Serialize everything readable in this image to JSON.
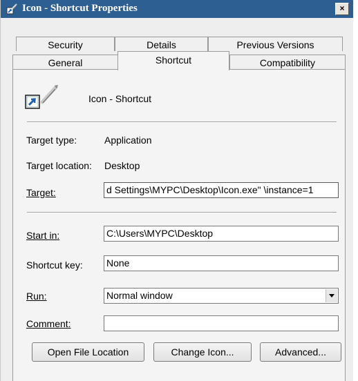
{
  "window": {
    "title": "Icon - Shortcut Properties",
    "close_glyph": "×"
  },
  "tabs": {
    "row1": [
      {
        "label": "Security"
      },
      {
        "label": "Details"
      },
      {
        "label": "Previous Versions"
      }
    ],
    "row2": [
      {
        "label": "General"
      },
      {
        "label": "Shortcut",
        "active": true
      },
      {
        "label": "Compatibility"
      }
    ]
  },
  "header": {
    "name": "Icon - Shortcut"
  },
  "info": {
    "target_type_label": "Target type:",
    "target_type_value": "Application",
    "target_location_label": "Target location:",
    "target_location_value": "Desktop"
  },
  "target": {
    "label": "Target:",
    "value": "d Settings\\MYPC\\Desktop\\Icon.exe\" \\instance=1"
  },
  "start_in": {
    "label": "Start in:",
    "value": "C:\\Users\\MYPC\\Desktop"
  },
  "shortcut_key": {
    "label": "Shortcut key:",
    "value": "None"
  },
  "run": {
    "label": "Run:",
    "value": "Normal window"
  },
  "comment": {
    "label": "Comment:",
    "value": ""
  },
  "buttons": {
    "open_file_location": "Open File Location",
    "change_icon": "Change Icon...",
    "advanced": "Advanced..."
  },
  "icons": {
    "title": "shortcut-icon",
    "header": "application-shortcut-icon",
    "dropdown": "chevron-down-icon"
  }
}
